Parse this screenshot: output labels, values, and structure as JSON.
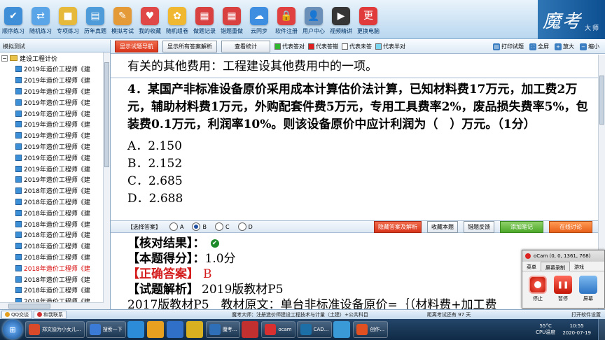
{
  "toolbar": {
    "items": [
      {
        "label": "顺序练习",
        "icon": "checklist-icon",
        "color": "#3f8fd8",
        "glyph": "✔"
      },
      {
        "label": "随机练习",
        "icon": "shuffle-icon",
        "color": "#5aa5e8",
        "glyph": "⇄"
      },
      {
        "label": "专项练习",
        "icon": "folder-icon",
        "color": "#e7b93a",
        "glyph": "■"
      },
      {
        "label": "历年真题",
        "icon": "book-icon",
        "color": "#4d9bd9",
        "glyph": "▤"
      },
      {
        "label": "模拟考试",
        "icon": "pen-paper-icon",
        "color": "#e49a36",
        "glyph": "✎"
      },
      {
        "label": "我的收藏",
        "icon": "heart-icon",
        "color": "#e04848",
        "glyph": "♥"
      },
      {
        "label": "随机组卷",
        "icon": "flower-icon",
        "color": "#f0b830",
        "glyph": "✿"
      },
      {
        "label": "做题记录",
        "icon": "calendar-icon",
        "color": "#d94040",
        "glyph": "▦"
      },
      {
        "label": "错题重做",
        "icon": "calendar-redo-icon",
        "color": "#d94040",
        "glyph": "▦"
      },
      {
        "label": "云同步",
        "icon": "cloud-icon",
        "color": "#3d8de0",
        "glyph": "☁"
      },
      {
        "label": "软件注册",
        "icon": "lock-icon",
        "color": "#e04040",
        "glyph": "🔒"
      },
      {
        "label": "用户中心",
        "icon": "user-icon",
        "color": "#6a8fb8",
        "glyph": "👤"
      },
      {
        "label": "视频精讲",
        "icon": "film-icon",
        "color": "#353535",
        "glyph": "▶"
      },
      {
        "label": "更换电脑",
        "icon": "computer-icon",
        "color": "#e03a3a",
        "glyph": "更"
      }
    ],
    "brand": "魔考",
    "brand_suffix": "大师"
  },
  "left": {
    "title": "模拟测试",
    "root": "建设工程计价",
    "items": [
      {
        "text": "2019年造价工程师《建",
        "selected": false
      },
      {
        "text": "2019年造价工程师《建",
        "selected": false
      },
      {
        "text": "2019年造价工程师《建",
        "selected": false
      },
      {
        "text": "2019年造价工程师《建",
        "selected": false
      },
      {
        "text": "2019年造价工程师《建",
        "selected": false
      },
      {
        "text": "2019年造价工程师《建",
        "selected": false
      },
      {
        "text": "2019年造价工程师《建",
        "selected": false
      },
      {
        "text": "2019年造价工程师《建",
        "selected": false
      },
      {
        "text": "2019年造价工程师《建",
        "selected": false
      },
      {
        "text": "2019年造价工程师《建",
        "selected": false
      },
      {
        "text": "2019年造价工程师《建",
        "selected": false
      },
      {
        "text": "2018年造价工程师《建",
        "selected": false
      },
      {
        "text": "2018年造价工程师《建",
        "selected": false
      },
      {
        "text": "2018年造价工程师《建",
        "selected": false
      },
      {
        "text": "2018年造价工程师《建",
        "selected": false
      },
      {
        "text": "2018年造价工程师《建",
        "selected": false
      },
      {
        "text": "2018年造价工程师《建",
        "selected": false
      },
      {
        "text": "2018年造价工程师《建",
        "selected": false
      },
      {
        "text": "2018年造价工程师《建",
        "selected": true
      },
      {
        "text": "2018年造价工程师《建",
        "selected": false
      },
      {
        "text": "2018年造价工程师《建",
        "selected": false
      },
      {
        "text": "2018年造价工程师《建",
        "selected": false
      }
    ]
  },
  "subbar": {
    "show_guide": "显示试题导航",
    "show_all": "显示所有答案解析",
    "view_stats": "查看统计",
    "legend": [
      {
        "label": "代表答对",
        "color": "#2fb52f"
      },
      {
        "label": "代表答错",
        "color": "#e02020"
      },
      {
        "label": "代表未答",
        "color": "#ffffff"
      },
      {
        "label": "代表半对",
        "color": "#7ad6f0"
      }
    ],
    "print": "打印试题",
    "fullscreen": "全屏",
    "zoom_in": "放大",
    "zoom_out": "缩小"
  },
  "question": {
    "prev_line": "有关的其他费用：工程建设其他费用中的一项。",
    "text": "4．某国产非标准设备原价采用成本计算估价法计算，已知材料费17万元，加工费2万元，辅助材料费1万元，外购配套件费5万元，专用工具费率2%，废品损失费率5%，包装费0.1万元，利润率10%。则该设备原价中应计利润为（　）万元。（1分）",
    "options": [
      "A．2.150",
      "B．2.152",
      "C．2.685",
      "D．2.688"
    ]
  },
  "answer_bar": {
    "label": "【选择答案】",
    "choices": [
      "A",
      "B",
      "C",
      "D"
    ],
    "selected": "B",
    "hide_answer": "隐藏答案及解析",
    "favorite": "收藏本题",
    "feedback": "错题反馈",
    "add_note": "添加笔记",
    "discuss": "在线讨论"
  },
  "result": {
    "check_label": "【核对结果】：",
    "score_label": "【本题得分】：",
    "score": "1.0分",
    "correct_label": "【正确答案】",
    "correct": "B",
    "analysis_label": "【试题解析】",
    "analysis_text": "2019版教材P5",
    "analysis_line2": "2017版教材P5　教材原文：单台非标准设备原价=｛（材料费+加工费"
  },
  "ocam": {
    "title": "oCam (0, 0, 1361, 768)",
    "menu": [
      "菜单",
      "屏幕录制",
      "游戏"
    ],
    "stop": "停止",
    "pause": "暂停",
    "screen": "屏幕"
  },
  "statusbar": {
    "qq": "QQ交谈",
    "contact": "和我联系",
    "center": "魔考大师：注册造价师建设工程技术与计量（土建）+公共科目",
    "exam_left": "距离考试还有 97 天",
    "open_dir": "打开软件设置"
  },
  "taskbar": {
    "items": [
      {
        "label": "郑文迪为小女儿...",
        "color": "#d84a2a"
      },
      {
        "label": "搜索一下",
        "color": "#3b7bd6"
      },
      {
        "label": "",
        "color": "#2d8cd8"
      },
      {
        "label": "",
        "color": "#e8a020"
      },
      {
        "label": "",
        "color": "#3070c8"
      },
      {
        "label": "",
        "color": "#d8b020"
      },
      {
        "label": "魔考...",
        "color": "#2f6fb8"
      },
      {
        "label": "",
        "color": "#c23030"
      },
      {
        "label": "ocam",
        "color": "#d83030"
      },
      {
        "label": "CAD...",
        "color": "#1d6fa8"
      },
      {
        "label": "",
        "color": "#3a9ad8"
      },
      {
        "label": "创作...",
        "color": "#e05020"
      }
    ],
    "cpu_temp": "55°C",
    "cpu_label": "CPU温度",
    "time": "10:55",
    "date": "2020-07-19"
  }
}
